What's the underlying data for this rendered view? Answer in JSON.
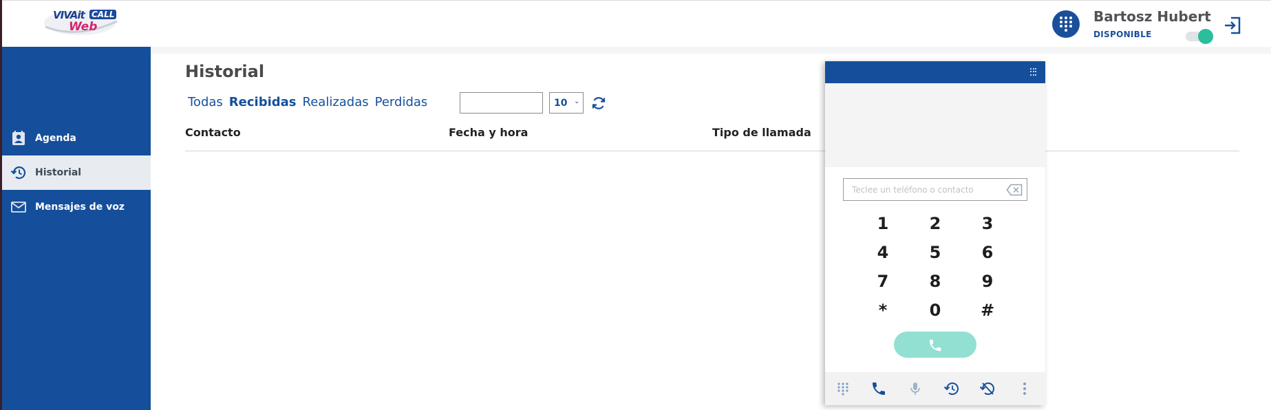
{
  "header": {
    "logo": {
      "brand": "VIVAit",
      "call": "CALL",
      "sub": "Web"
    },
    "user": {
      "name": "Bartosz Hubert",
      "status": "DISPONIBLE",
      "available": true
    }
  },
  "sidebar": {
    "items": [
      {
        "label": "Agenda",
        "icon": "contact-book-icon"
      },
      {
        "label": "Historial",
        "icon": "history-icon",
        "active": true
      },
      {
        "label": "Mensajes de voz",
        "icon": "mail-icon"
      }
    ]
  },
  "main": {
    "title": "Historial",
    "tabs": [
      {
        "label": "Todas"
      },
      {
        "label": "Recibidas",
        "active": true
      },
      {
        "label": "Realizadas"
      },
      {
        "label": "Perdidas"
      }
    ],
    "search": {
      "value": ""
    },
    "page_size": "10",
    "columns": [
      "Contacto",
      "Fecha y hora",
      "Tipo de llamada"
    ],
    "rows": []
  },
  "dialer": {
    "input_placeholder": "Teclee un teléfono o contacto",
    "keys": [
      "1",
      "2",
      "3",
      "4",
      "5",
      "6",
      "7",
      "8",
      "9",
      "*",
      "0",
      "#"
    ],
    "footer_icons": [
      "keypad-icon",
      "phone-icon",
      "microphone-icon",
      "call-history-icon",
      "do-not-disturb-icon",
      "more-vertical-icon"
    ]
  },
  "colors": {
    "brand_blue": "#154f9b",
    "accent_green": "#2bbd9c",
    "call_button": "#92e0d1",
    "logo_pink": "#d6246e"
  }
}
